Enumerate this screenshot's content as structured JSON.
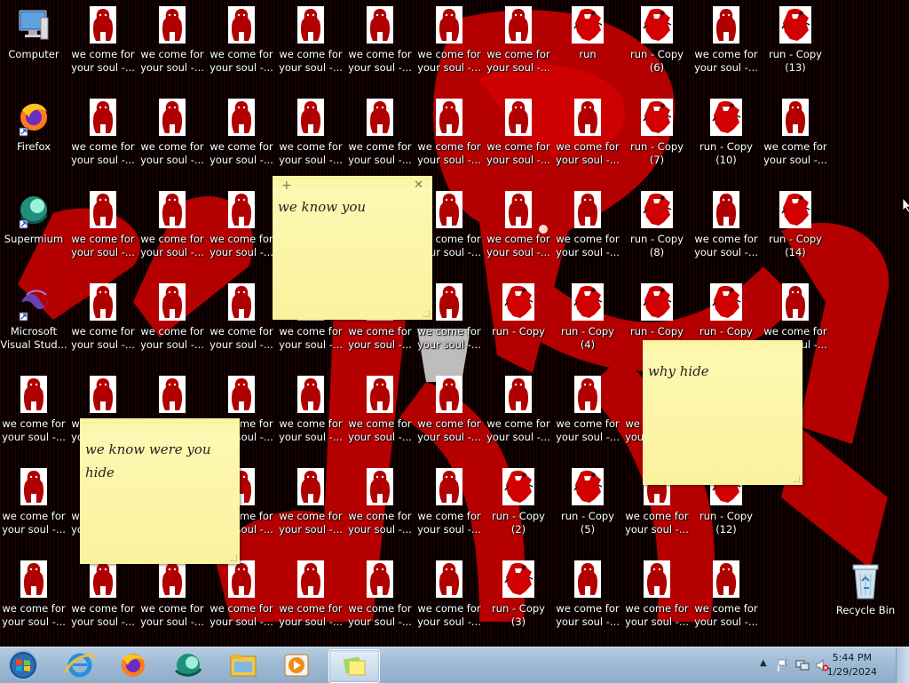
{
  "desktop": {
    "system_icons": [
      {
        "label": "Computer",
        "icon": "computer-icon"
      },
      {
        "label": "Firefox",
        "icon": "firefox-icon"
      },
      {
        "label": "Supermium",
        "icon": "supermium-icon"
      },
      {
        "label": "Microsoft Visual Stud...",
        "icon": "visual-studio-icon"
      }
    ],
    "recycle_bin": {
      "label": "Recycle Bin",
      "icon": "recycle-bin-icon"
    },
    "file_label_soul": "we come for your soul -...",
    "file_labels_run": {
      "run": "run",
      "c6": "run - Copy (6)",
      "c13": "run - Copy (13)",
      "c7": "run - Copy (7)",
      "c10": "run - Copy (10)",
      "c8": "run - Copy (8)",
      "c14": "run - Copy (14)",
      "c": "run - Copy",
      "c4": "run - Copy (4)",
      "c9": "run - Copy (9)",
      "c2": "run - Copy (2)",
      "c5": "run - Copy (5)",
      "c12": "run - Copy (12)",
      "c3": "run - Copy (3)"
    },
    "grid": [
      [
        "Computer",
        "soul",
        "soul",
        "soul",
        "soul",
        "soul",
        "soul",
        "soul",
        "run",
        "c6",
        "soul",
        "c13"
      ],
      [
        "Firefox",
        "soul",
        "soul",
        "soul",
        "soul",
        "soul",
        "soul",
        "soul",
        "soul",
        "c7",
        "c10",
        "soul"
      ],
      [
        "Supermium",
        "soul",
        "soul",
        "soul",
        "soul",
        "soul",
        "soul",
        "soul",
        "soul",
        "c8",
        "soul",
        "c14"
      ],
      [
        "Microsoft Visual Stud...",
        "soul",
        "soul",
        "soul",
        "soul",
        "soul",
        "soul",
        "c",
        "c4",
        "c9",
        "c",
        "soul"
      ],
      [
        "soul",
        "soul",
        "soul",
        "soul",
        "soul",
        "soul",
        "soul",
        "soul",
        "soul",
        "soul",
        "soul",
        ""
      ],
      [
        "soul",
        "soul",
        "soul",
        "soul",
        "soul",
        "soul",
        "soul",
        "c2",
        "c5",
        "soul",
        "c12",
        ""
      ],
      [
        "soul",
        "soul",
        "soul",
        "soul",
        "soul",
        "soul",
        "soul",
        "c3",
        "soul",
        "soul",
        "soul",
        ""
      ]
    ]
  },
  "sticky_notes": [
    {
      "text": "we know you"
    },
    {
      "text": "why hide"
    },
    {
      "text": "we know were you hide"
    }
  ],
  "taskbar": {
    "apps": [
      "start-orb",
      "internet-explorer-icon",
      "firefox-icon",
      "supermium-icon",
      "file-explorer-icon",
      "media-player-icon",
      "sticky-notes-icon"
    ],
    "time": "5:44 PM",
    "date": "1/29/2024"
  },
  "colors": {
    "accent_red": "#d10000",
    "note_yellow": "#fbf29e",
    "taskbar": "#9fbad4"
  }
}
